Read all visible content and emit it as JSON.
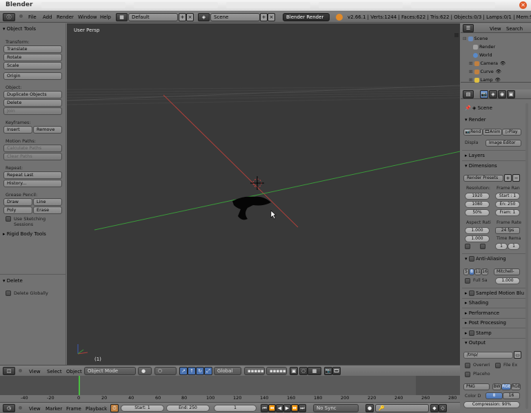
{
  "window": {
    "title": "Blender"
  },
  "info_bar": {
    "menus": [
      "File",
      "Add",
      "Render",
      "Window",
      "Help"
    ],
    "screen_layout": "Default",
    "scene": "Scene",
    "render_engine": "Blender Render",
    "stats": "v2.66.1 | Verts:1244 | Faces:622 | Tris:622 | Objects:0/3 | Lamps:0/1 | Mem:9.64M (0.1"
  },
  "tool_shelf": {
    "header": "Object Tools",
    "transform_label": "Transform:",
    "translate": "Translate",
    "rotate": "Rotate",
    "scale": "Scale",
    "origin": "Origin",
    "object_label": "Object:",
    "duplicate": "Duplicate Objects",
    "delete": "Delete",
    "join": "Join",
    "keyframes_label": "Keyframes:",
    "insert": "Insert",
    "remove": "Remove",
    "motion_paths_label": "Motion Paths:",
    "calculate_paths": "Calculate Paths",
    "clear_paths": "Clear Paths",
    "repeat_label": "Repeat:",
    "repeat_last": "Repeat Last",
    "history": "History...",
    "grease_pencil_label": "Grease Pencil:",
    "draw": "Draw",
    "line": "Line",
    "poly": "Poly",
    "erase": "Erase",
    "sketching_sessions": "Use Sketching Sessions",
    "rigid_body": "Rigid Body Tools",
    "delete_panel": "Delete",
    "delete_globally": "Delete Globally"
  },
  "viewport": {
    "label": "User Persp",
    "frame": "(1)"
  },
  "outliner": {
    "view": "View",
    "search": "Search",
    "items": [
      "Scene",
      "Render",
      "World",
      "Camera",
      "Curve",
      "Lamp"
    ]
  },
  "properties": {
    "scene_path": "Scene",
    "render_panel": "Render",
    "render_btn": "Rend",
    "anim_btn": "Anim",
    "play_btn": "Play",
    "display_label": "Displa",
    "display_value": "Image Editor",
    "layers_panel": "Layers",
    "dimensions_panel": "Dimensions",
    "render_presets": "Render Presets",
    "resolution_label": "Resolution:",
    "frame_range_label": "Frame Ran",
    "res_x": "1920",
    "res_y": "1080",
    "res_pct": "50%",
    "start": "Start : 1",
    "end": "En: 250",
    "step": "Fram: 1",
    "aspect_label": "Aspect Rati",
    "frame_rate_label": "Frame Rate",
    "aspect_x": "1.000",
    "aspect_y": "1.000",
    "fps": "24 fps",
    "time_remap_label": "Time Rema",
    "remap_old": "1",
    "remap_new": "1",
    "aa_panel": "Anti-Aliasing",
    "aa_samples": [
      "5",
      "8",
      "11",
      "16"
    ],
    "aa_filter": "Mitchell-",
    "full_sample": "Full Sa",
    "aa_size": "1.000",
    "sampled_motion_blur": "Sampled Motion Blu",
    "shading_panel": "Shading",
    "performance_panel": "Performance",
    "post_processing_panel": "Post Processing",
    "stamp_panel": "Stamp",
    "output_panel": "Output",
    "output_path": "/tmp/",
    "overwrite": "Overwri",
    "file_ext": "File Ex",
    "placeholders": "Placeho",
    "format": "PNG",
    "color_modes": [
      "BW",
      "RGB",
      "RGB"
    ],
    "color_depth_label": "Color D",
    "color_depths": [
      "8",
      "16"
    ],
    "compression": "Compression: 90%"
  },
  "timeline_header": {
    "menus": [
      "View",
      "Select",
      "Object"
    ],
    "mode": "Object Mode",
    "orientation": "Global"
  },
  "timeline": {
    "ticks": [
      "-40",
      "-20",
      "0",
      "20",
      "40",
      "60",
      "80",
      "100",
      "120",
      "140",
      "160",
      "180",
      "200",
      "220",
      "240",
      "260",
      "280"
    ]
  },
  "timeline_footer": {
    "menus": [
      "View",
      "Marker",
      "Frame",
      "Playback"
    ],
    "start": "Start: 1",
    "end": "End: 250",
    "current": "1",
    "sync": "No Sync"
  },
  "colors": {
    "x_axis": "#b0403a",
    "y_axis": "#3a9a3a",
    "z_axis": "#3a5ab8",
    "viewport_bg": "#393939",
    "selection_blue": "#4a72b0"
  }
}
